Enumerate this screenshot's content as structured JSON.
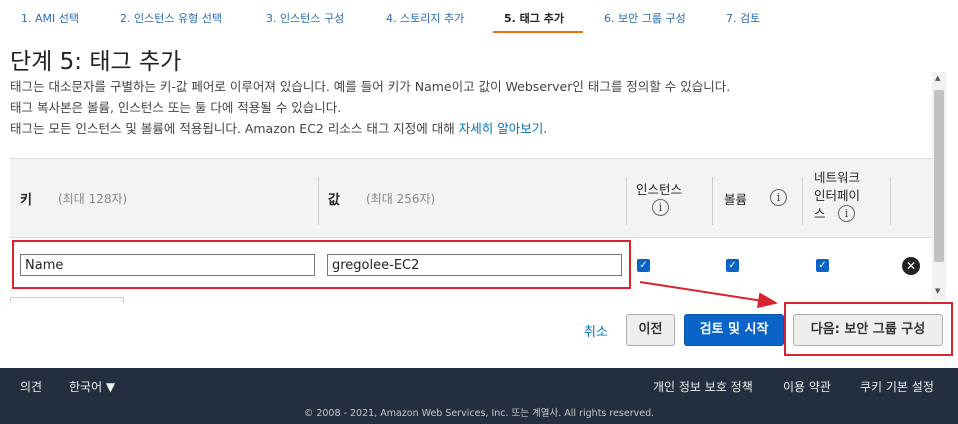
{
  "steps": [
    {
      "label": "1. AMI 선택",
      "active": false
    },
    {
      "label": "2. 인스턴스 유형 선택",
      "active": false
    },
    {
      "label": "3. 인스턴스 구성",
      "active": false
    },
    {
      "label": "4. 스토리지 추가",
      "active": false
    },
    {
      "label": "5. 태그 추가",
      "active": true
    },
    {
      "label": "6. 보안 그룹 구성",
      "active": false
    },
    {
      "label": "7. 검토",
      "active": false
    }
  ],
  "page_title": "단계 5: 태그 추가",
  "description": {
    "line1": "태그는 대소문자를 구별하는 키-값 페어로 이루어져 있습니다. 예를 들어 키가 Name이고 값이 Webserver인 태그를 정의할 수 있습니다.",
    "line2": "태그 복사본은 볼륨, 인스턴스 또는 둘 다에 적용될 수 있습니다.",
    "line3_prefix": "태그는 모든 인스턴스 및 볼륨에 적용됩니다. Amazon EC2 리소스 태그 지정에 대해 ",
    "line3_link": "자세히 알아보기",
    "line3_suffix": "."
  },
  "table": {
    "key_header": "키",
    "key_hint": "(최대 128자)",
    "value_header": "값",
    "value_hint": "(최대 256자)",
    "instances_header": "인스턴스",
    "volumes_header": "볼륨",
    "network_header_1": "네트워크",
    "network_header_2": "인터페이",
    "network_header_3": "스",
    "info_glyph": "i",
    "rows": [
      {
        "key": "Name",
        "value": "gregolee-EC2",
        "instances": true,
        "volumes": true,
        "network_interfaces": true
      }
    ]
  },
  "buttons": {
    "cancel": "취소",
    "previous": "이전",
    "review_launch": "검토 및 시작",
    "next": "다음: 보안 그룹 구성"
  },
  "footer": {
    "feedback": "의견",
    "language": "한국어 ▼",
    "privacy": "개인 정보 보호 정책",
    "terms": "이용 약관",
    "cookies": "쿠키 기본 설정",
    "copyright": "© 2008 - 2021, Amazon Web Services, Inc. 또는 계열사. All rights reserved."
  },
  "colors": {
    "accent_orange": "#ec7211",
    "primary_blue": "#0a64c8",
    "highlight_red": "#d9232e",
    "footer_bg": "#232f3e"
  }
}
